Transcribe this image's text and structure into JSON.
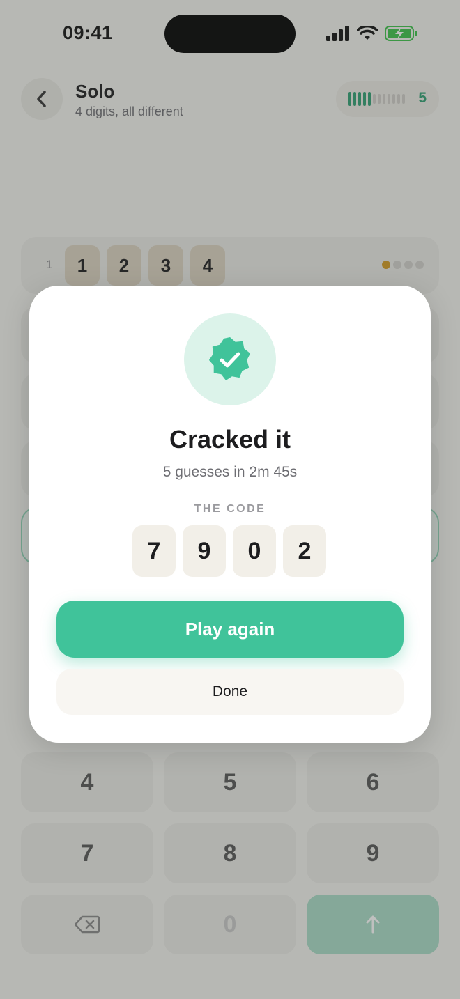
{
  "status_bar": {
    "time": "09:41"
  },
  "header": {
    "title": "Solo",
    "subtitle": "4 digits, all different",
    "guess_meter": {
      "used": 5,
      "total": 12,
      "count_label": "5"
    }
  },
  "board": {
    "first_row": {
      "row_number": "1",
      "digits": [
        "1",
        "2",
        "3",
        "4"
      ],
      "feedback": [
        "partial",
        "none",
        "none",
        "none"
      ]
    }
  },
  "keypad": {
    "keys": [
      "4",
      "5",
      "6",
      "7",
      "8",
      "9",
      "0"
    ]
  },
  "modal": {
    "title": "Cracked it",
    "summary": "5 guesses in 2m 45s",
    "code_label": "THE CODE",
    "code_digits": [
      "7",
      "9",
      "0",
      "2"
    ],
    "primary_button": "Play again",
    "secondary_button": "Done",
    "icon": "verified-badge-icon"
  },
  "colors": {
    "accent": "#40c39a",
    "partial_dot": "#d29a22"
  }
}
